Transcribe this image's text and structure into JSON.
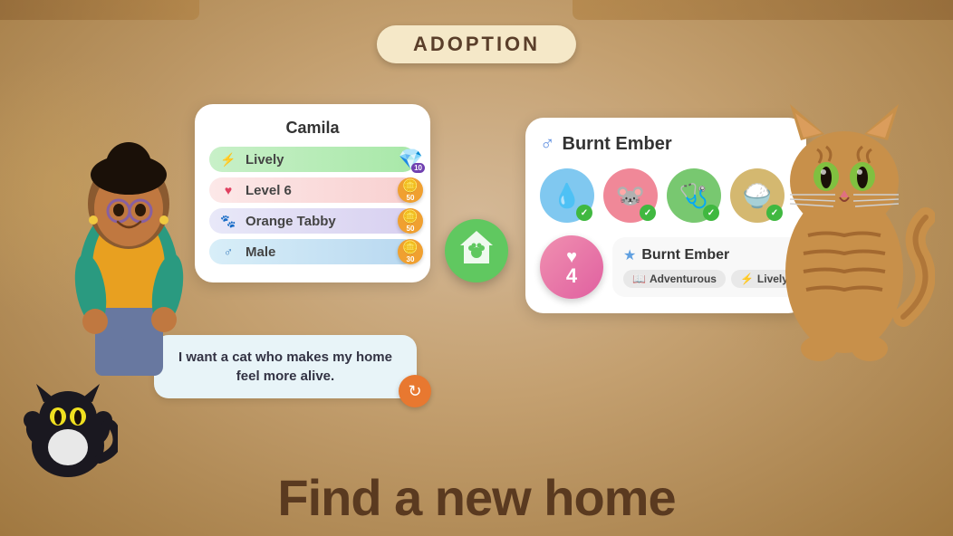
{
  "page": {
    "background_color": "#c8a882"
  },
  "adoption_banner": {
    "label": "ADOPTION"
  },
  "camila_card": {
    "title": "Camila",
    "stats": [
      {
        "id": "lively",
        "icon": "⚡",
        "label": "Lively",
        "cost_type": "gem",
        "cost": 10,
        "color": "lively"
      },
      {
        "id": "level",
        "icon": "♥",
        "label": "Level 6",
        "cost_type": "coin",
        "cost": 50,
        "color": "level"
      },
      {
        "id": "tabby",
        "icon": "🐾",
        "label": "Orange Tabby",
        "cost_type": "coin",
        "cost": 50,
        "color": "tabby"
      },
      {
        "id": "male",
        "icon": "♂",
        "label": "Male",
        "cost_type": "coin",
        "cost": 30,
        "color": "male"
      }
    ]
  },
  "speech_bubble": {
    "text": "I want a cat who makes my home feel more alive."
  },
  "adopt_button": {
    "label": "🏠"
  },
  "cat_card": {
    "title": "Burnt Ember",
    "gender": "♂",
    "traits": [
      {
        "id": "water",
        "icon": "💧",
        "color": "blue",
        "checked": true
      },
      {
        "id": "rodent",
        "icon": "🐭",
        "color": "pink",
        "checked": true
      },
      {
        "id": "health",
        "icon": "🩺",
        "color": "green",
        "checked": true
      },
      {
        "id": "food",
        "icon": "🍚",
        "color": "tan",
        "checked": true
      }
    ],
    "match": {
      "number": "4",
      "name": "Burnt Ember",
      "tags": [
        {
          "icon": "📖",
          "label": "Adventurous"
        },
        {
          "icon": "⚡",
          "label": "Lively"
        }
      ]
    }
  },
  "bottom_title": "Find a new home",
  "refresh_button": {
    "label": "↻"
  }
}
